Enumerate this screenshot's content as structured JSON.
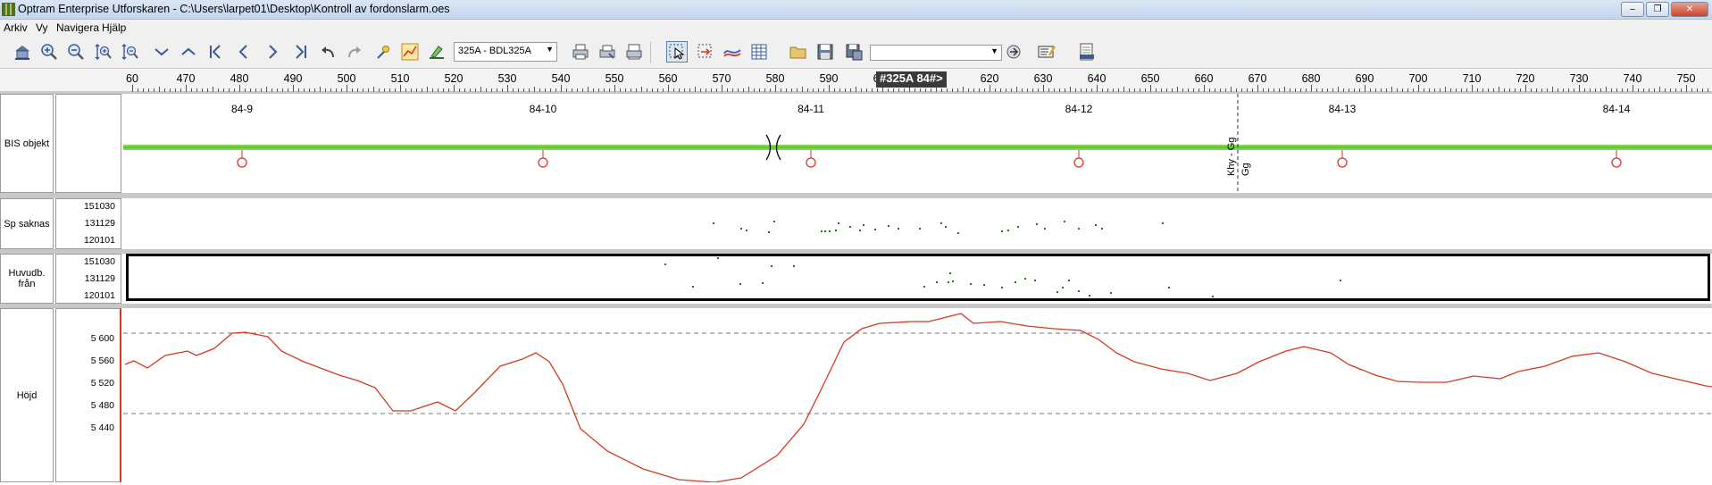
{
  "window": {
    "title": "Optram Enterprise Utforskaren - C:\\Users\\larpet01\\Desktop\\Kontroll av fordonslarm.oes",
    "minimize": "–",
    "restore": "❐",
    "close": "✕"
  },
  "menu": [
    "Arkiv",
    "Vy",
    "Navigera",
    "Hjälp"
  ],
  "toolbar": {
    "track_combo": "325A - BDL325A",
    "empty_combo": ""
  },
  "ruler": {
    "labels": [
      "60",
      "470",
      "480",
      "490",
      "500",
      "510",
      "520",
      "530",
      "540",
      "550",
      "560",
      "570",
      "580",
      "590",
      "600",
      "610",
      "620",
      "630",
      "640",
      "650",
      "660",
      "670",
      "680",
      "690",
      "700",
      "710",
      "720",
      "730",
      "740",
      "750"
    ],
    "position_marker": "#325A 84#>"
  },
  "bis": {
    "label": "BIS objekt",
    "km_labels": [
      "84-9",
      "84-10",
      "84-11",
      "84-12",
      "84-13",
      "84-14"
    ],
    "vertical_text_1": "Khy - Gg",
    "vertical_text_2": "Gg"
  },
  "sp_saknas": {
    "label": "Sp saknas",
    "scale": [
      "151030",
      "131129",
      "120101"
    ]
  },
  "huvudb": {
    "label": "Huvudb. från",
    "scale": [
      "151030",
      "131129",
      "120101"
    ]
  },
  "hojd": {
    "label": "Höjd",
    "scale": [
      "5 600",
      "5 560",
      "5 520",
      "5 480",
      "5 440"
    ]
  },
  "colors": {
    "track_green": "#7cd94a",
    "marker_red": "#d9362b",
    "point_green": "#1a7a1a",
    "line_red": "#d33a22"
  }
}
